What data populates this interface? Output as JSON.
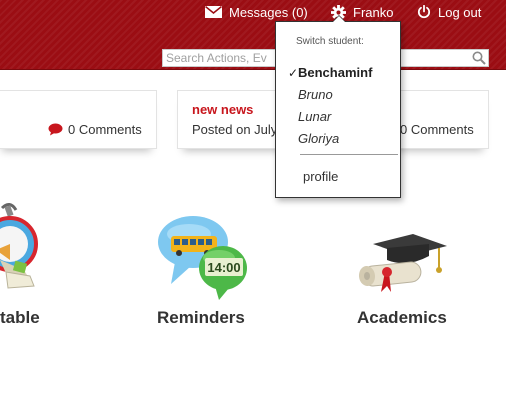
{
  "header": {
    "messages_label": "Messages (0)",
    "user_label": "Franko",
    "logout_label": "Log out",
    "search_placeholder": "Search Actions, Ev"
  },
  "news": [
    {
      "title": "",
      "posted": "",
      "comments": "0 Comments"
    },
    {
      "title": "new news",
      "posted": "Posted on July",
      "comments": "0 Comments"
    }
  ],
  "dropdown": {
    "title": "Switch student:",
    "check_mark": "✓",
    "students": [
      "Benchaminf",
      "Bruno",
      "Lunar",
      "Gloriya"
    ],
    "selected_index": 0,
    "profile_label": "profile"
  },
  "tiles": [
    {
      "label": "table",
      "icon": "alarm-clock-icon"
    },
    {
      "label": "Reminders",
      "icon": "reminder-bus-clock-icon"
    },
    {
      "label": "Academics",
      "icon": "graduation-cap-diploma-icon"
    }
  ],
  "colors": {
    "header": "#9b0d13",
    "news_title": "#c8161d",
    "comment_icon": "#c8161d"
  }
}
